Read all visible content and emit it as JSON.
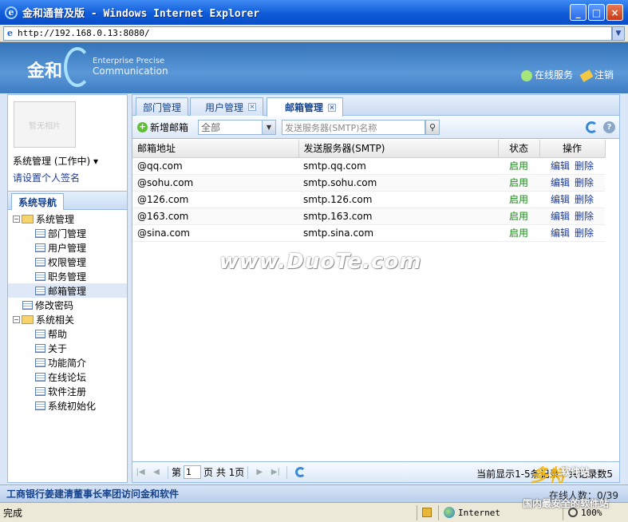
{
  "window": {
    "title": "金和通普及版 - Windows Internet Explorer",
    "minimize": "_",
    "maximize": "□",
    "close": "×"
  },
  "address_bar": {
    "url": "http://192.168.0.13:8080/"
  },
  "header": {
    "logo_cn": "金和",
    "logo_en_line1": "Enterprise Precise",
    "logo_en_line2": "Communication",
    "links": {
      "online_service": "在线服务",
      "logout": "注销"
    }
  },
  "sidebar": {
    "photo_placeholder": "暂无相片",
    "user_role": "系统管理 (工作中)",
    "set_signature": "请设置个人签名",
    "nav_tab": "系统导航",
    "tree": [
      {
        "label": "系统管理",
        "type": "folder",
        "level": 0
      },
      {
        "label": "部门管理",
        "type": "leaf",
        "level": 1
      },
      {
        "label": "用户管理",
        "type": "leaf",
        "level": 1
      },
      {
        "label": "权限管理",
        "type": "leaf",
        "level": 1
      },
      {
        "label": "职务管理",
        "type": "leaf",
        "level": 1
      },
      {
        "label": "邮箱管理",
        "type": "leaf",
        "level": 1,
        "selected": true
      },
      {
        "label": "修改密码",
        "type": "leaf",
        "level": 0
      },
      {
        "label": "系统相关",
        "type": "folder",
        "level": 0
      },
      {
        "label": "帮助",
        "type": "leaf",
        "level": 1
      },
      {
        "label": "关于",
        "type": "leaf",
        "level": 1
      },
      {
        "label": "功能简介",
        "type": "leaf",
        "level": 1
      },
      {
        "label": "在线论坛",
        "type": "leaf",
        "level": 1
      },
      {
        "label": "软件注册",
        "type": "leaf",
        "level": 1
      },
      {
        "label": "系统初始化",
        "type": "leaf",
        "level": 1
      }
    ]
  },
  "tabs": [
    {
      "label": "部门管理",
      "closable": false
    },
    {
      "label": "用户管理",
      "closable": true
    },
    {
      "label": "邮箱管理",
      "closable": true,
      "active": true
    }
  ],
  "toolbar": {
    "add_label": "新增邮箱",
    "status_select_value": "全部",
    "search_placeholder": "发送服务器(SMTP)名称"
  },
  "grid": {
    "columns": [
      "邮箱地址",
      "发送服务器(SMTP)",
      "状态",
      "操作"
    ],
    "rows": [
      {
        "email": "@qq.com",
        "smtp": "smtp.qq.com",
        "status": "启用",
        "edit": "编辑",
        "delete": "删除"
      },
      {
        "email": "@sohu.com",
        "smtp": "smtp.sohu.com",
        "status": "启用",
        "edit": "编辑",
        "delete": "删除"
      },
      {
        "email": "@126.com",
        "smtp": "smtp.126.com",
        "status": "启用",
        "edit": "编辑",
        "delete": "删除"
      },
      {
        "email": "@163.com",
        "smtp": "smtp.163.com",
        "status": "启用",
        "edit": "编辑",
        "delete": "删除"
      },
      {
        "email": "@sina.com",
        "smtp": "smtp.sina.com",
        "status": "启用",
        "edit": "编辑",
        "delete": "删除"
      }
    ]
  },
  "pager": {
    "page_prefix": "第",
    "page_value": "1",
    "page_suffix": "页 共 1页",
    "info": "当前显示1-5条记录 / 共记录数5"
  },
  "footer": {
    "marquee": "工商银行姜建清董事长率团访问金和软件",
    "online": "在线人数：0/39"
  },
  "statusbar": {
    "status": "完成",
    "zone": "Internet",
    "zoom": "100%"
  },
  "watermark": {
    "text": "www.DuoTe.com",
    "corner_a": "多特",
    "corner_b": "软件站",
    "corner_c": "国内最安全的软件站"
  },
  "colors": {
    "accent": "#15428b",
    "status_enabled": "#1a8a1a",
    "link": "#1b3a9b"
  }
}
